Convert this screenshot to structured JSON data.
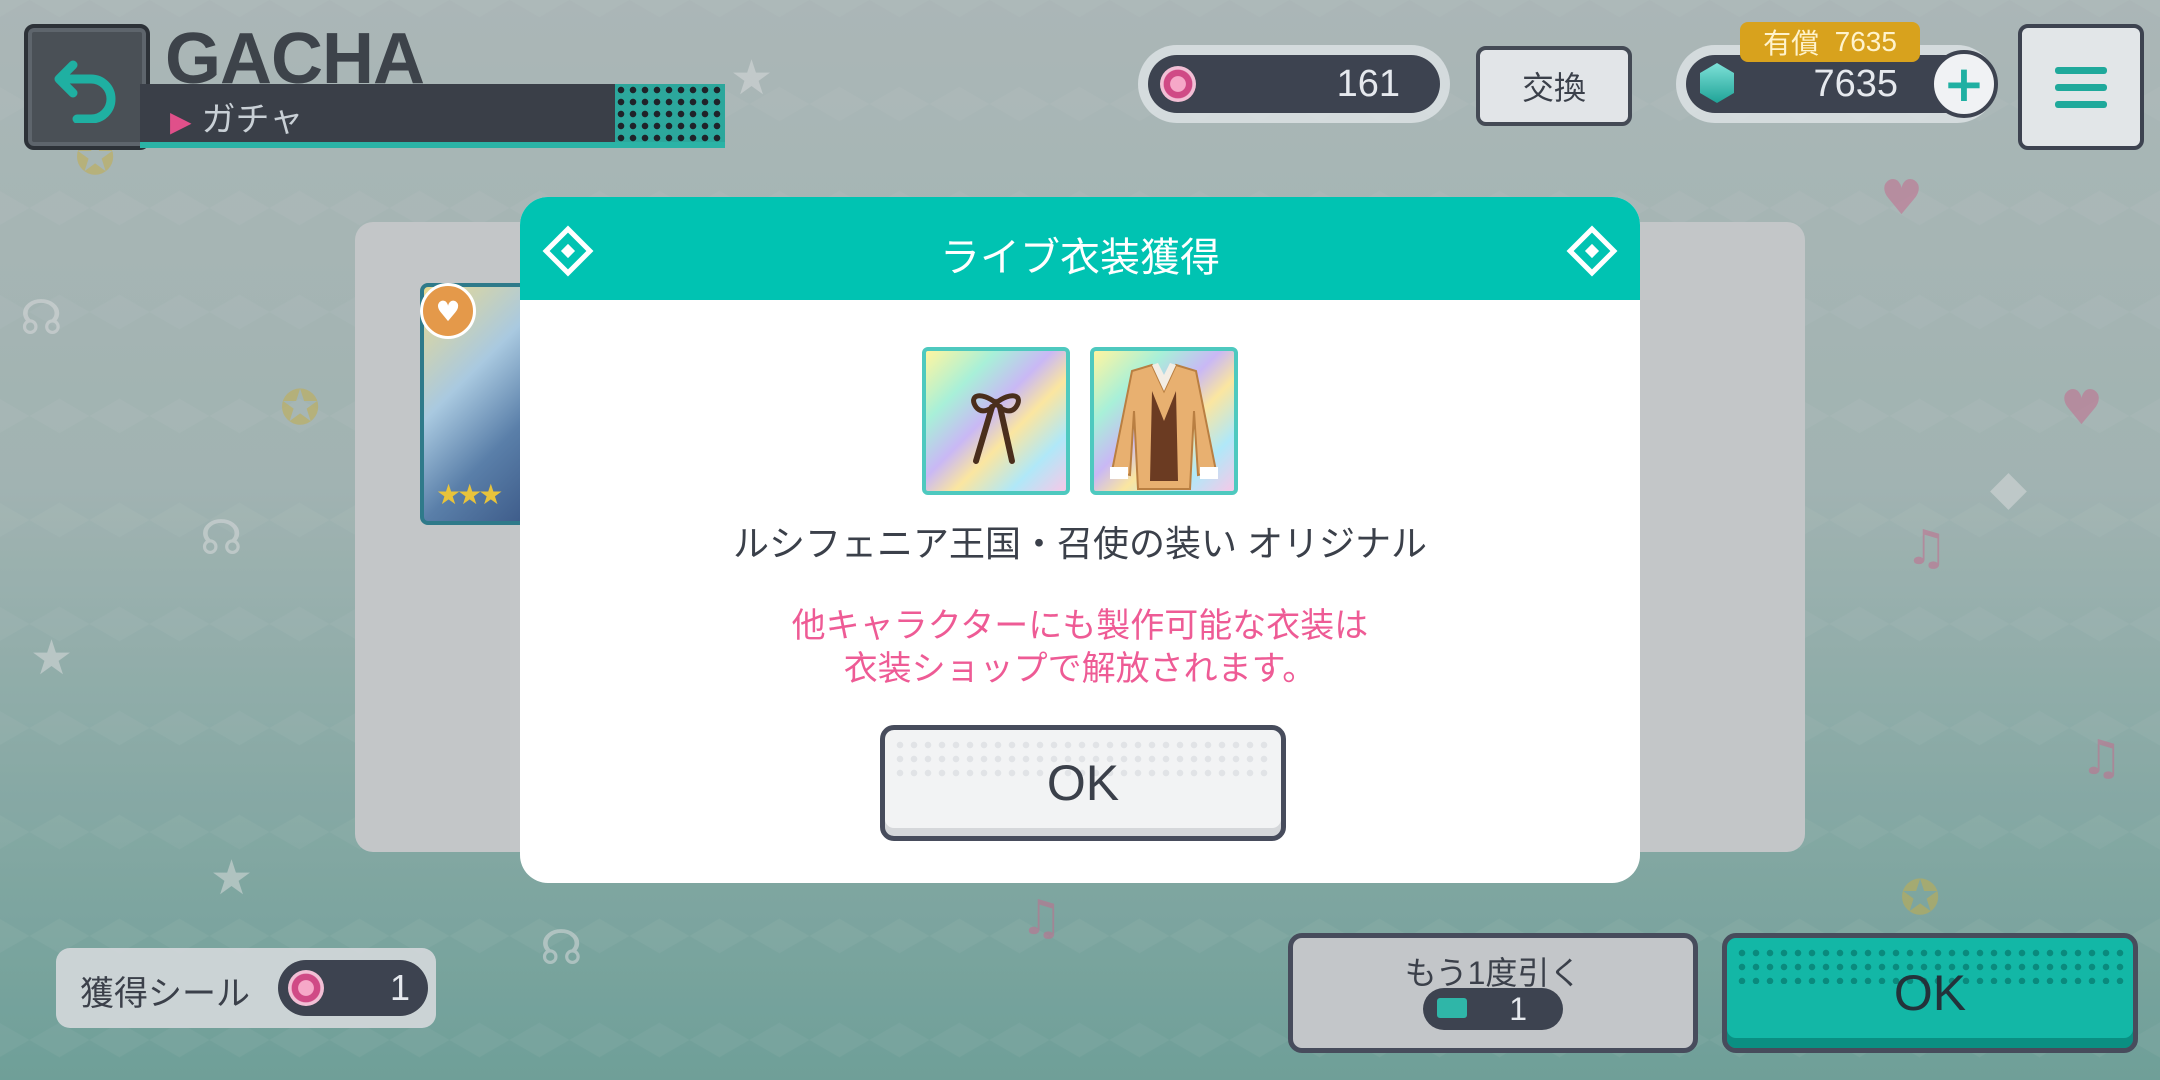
{
  "header": {
    "title": "GACHA",
    "subtitle": "ガチャ"
  },
  "currency": {
    "seal_count": "161",
    "exchange_label": "交換",
    "paid_label": "有償",
    "paid_value": "7635",
    "gem_count": "7635",
    "add_label": "+"
  },
  "modal": {
    "title": "ライブ衣装獲得",
    "outfit_name": "ルシフェニア王国・召使の装い オリジナル",
    "notice_line1": "他キャラクターにも製作可能な衣装は",
    "notice_line2": "衣装ショップで解放されます。",
    "ok_label": "OK"
  },
  "bottom": {
    "seal_label": "獲得シール",
    "seal_value": "1",
    "again_label": "もう1度引く",
    "again_ticket_value": "1",
    "ok_label": "OK"
  },
  "colors": {
    "accent": "#00c3b2",
    "notice_pink": "#ee5b95",
    "dark": "#3d4350"
  },
  "icons": [
    "back-arrow-icon",
    "menu-icon",
    "seal-coin-icon",
    "gem-icon",
    "plus-icon",
    "diamond-icon",
    "ribbon-item-icon",
    "jacket-item-icon",
    "ticket-icon",
    "heart-icon",
    "star-icon"
  ]
}
